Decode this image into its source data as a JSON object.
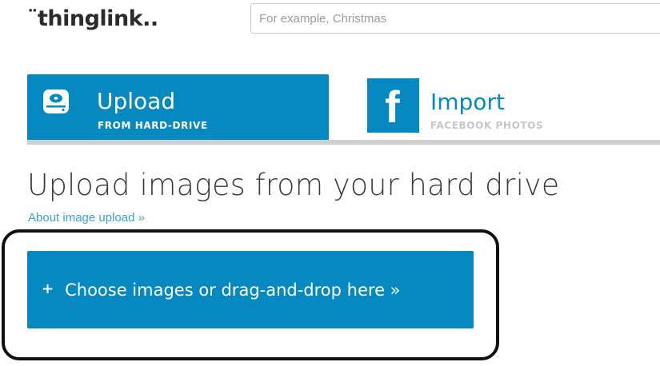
{
  "header": {
    "logo_text": "¨thinglink..",
    "search_placeholder": "For example, Christmas"
  },
  "tabs": [
    {
      "title": "Upload",
      "subtitle": "FROM HARD-DRIVE",
      "icon": "hard-drive-icon",
      "active": true
    },
    {
      "title": "Import",
      "subtitle": "FACEBOOK PHOTOS",
      "icon": "facebook-icon",
      "icon_glyph": "f",
      "active": false
    }
  ],
  "main": {
    "title": "Upload images from your hard drive",
    "about_link": "About image upload »",
    "choose_button": {
      "icon_glyph": "+",
      "label": "Choose images or drag-and-drop here »"
    }
  },
  "colors": {
    "accent": "#0689c0",
    "link": "#3aa3d4",
    "muted": "#c7c7c7",
    "tab_rule": "#cfcfcf"
  }
}
